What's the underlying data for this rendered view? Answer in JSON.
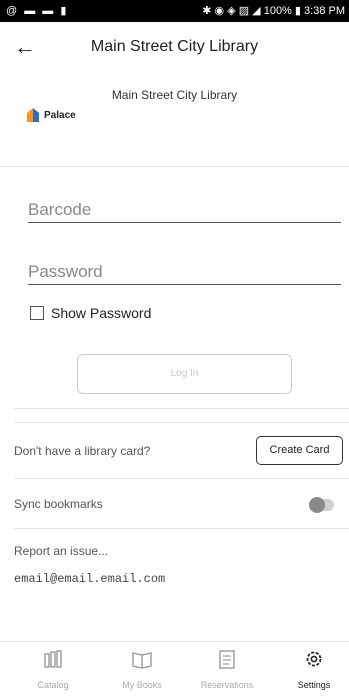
{
  "status_bar": {
    "left_icons": "@ ▬ ▬ ▮",
    "battery": "100%",
    "time": "3:38 PM"
  },
  "app_bar": {
    "title": "Main Street City Library"
  },
  "library": {
    "name": "Main Street City Library",
    "logo_text": "Palace"
  },
  "login": {
    "barcode_placeholder": "Barcode",
    "password_placeholder": "Password",
    "show_password_label": "Show Password",
    "login_label": "Log In"
  },
  "card": {
    "question": "Don't have a library card?",
    "create_label": "Create Card"
  },
  "sync": {
    "label": "Sync bookmarks",
    "enabled": false
  },
  "report": {
    "label": "Report an issue...",
    "email": "email@email.email.com"
  },
  "tabs": [
    {
      "label": "Catalog",
      "icon": "catalog-icon"
    },
    {
      "label": "My Books",
      "icon": "book-icon"
    },
    {
      "label": "Reservations",
      "icon": "reservations-icon"
    },
    {
      "label": "Settings",
      "icon": "gear-icon"
    }
  ],
  "colors": {
    "logo_orange": "#f7931e",
    "logo_blue": "#2f6db5"
  }
}
